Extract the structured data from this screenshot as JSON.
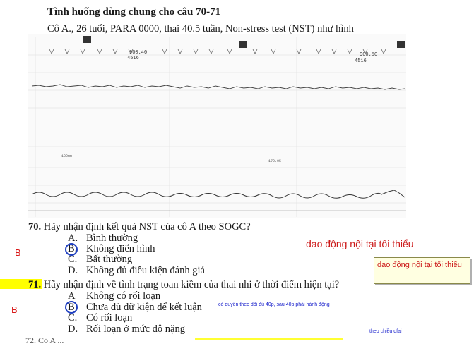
{
  "heading": "Tình huống dùng chung cho câu 70-71",
  "case_text": "Cô A., 26 tuổi, PARA 0000, thai 40.5 tuần, Non-stress test (NST) như hình",
  "ctg_labels": {
    "header_left": "900.40",
    "header_left_sub": "4516",
    "header_right": "900.50",
    "header_right_sub": "4516",
    "mid_left": "100mm",
    "mid_right": "179.05"
  },
  "q70": {
    "number": "70.",
    "text": "Hãy nhận định kết quả NST của cô A theo SOGC?",
    "options": [
      {
        "letter": "A.",
        "text": "Bình thường"
      },
      {
        "letter": "B.",
        "text": "Không điển hình"
      },
      {
        "letter": "C.",
        "text": "Bất thường"
      },
      {
        "letter": "D.",
        "text": "Không đủ điều kiện đánh giá"
      }
    ],
    "answer_mark": "B"
  },
  "q71": {
    "number": "71.",
    "text": "Hãy nhận định về tình trạng toan kiềm của thai nhi ở thời điểm hiện tại?",
    "options": [
      {
        "letter": "A",
        "text": "Không có rối loạn"
      },
      {
        "letter": "B",
        "text": "Chưa đủ dữ kiện để kết luận"
      },
      {
        "letter": "C.",
        "text": "Có rối loạn"
      },
      {
        "letter": "D.",
        "text": "Rối loạn ở mức độ nặng"
      }
    ],
    "answer_mark": "B"
  },
  "annotations": {
    "big_note": "dao động  nội tại tối thiểu",
    "box_note": "dao động  nội tại tối thiểu",
    "blue_note": "có quyền theo dõi đủ 40p, sau 40p phải hành động",
    "blue_note_2": "theo chiều dfai"
  },
  "cut_text": "72. Cô A ...",
  "colors": {
    "annotation_red": "#cc1a1a",
    "annotation_blue": "#1a22cc",
    "highlight": "#ffff00",
    "circle": "#1f3fbf"
  }
}
